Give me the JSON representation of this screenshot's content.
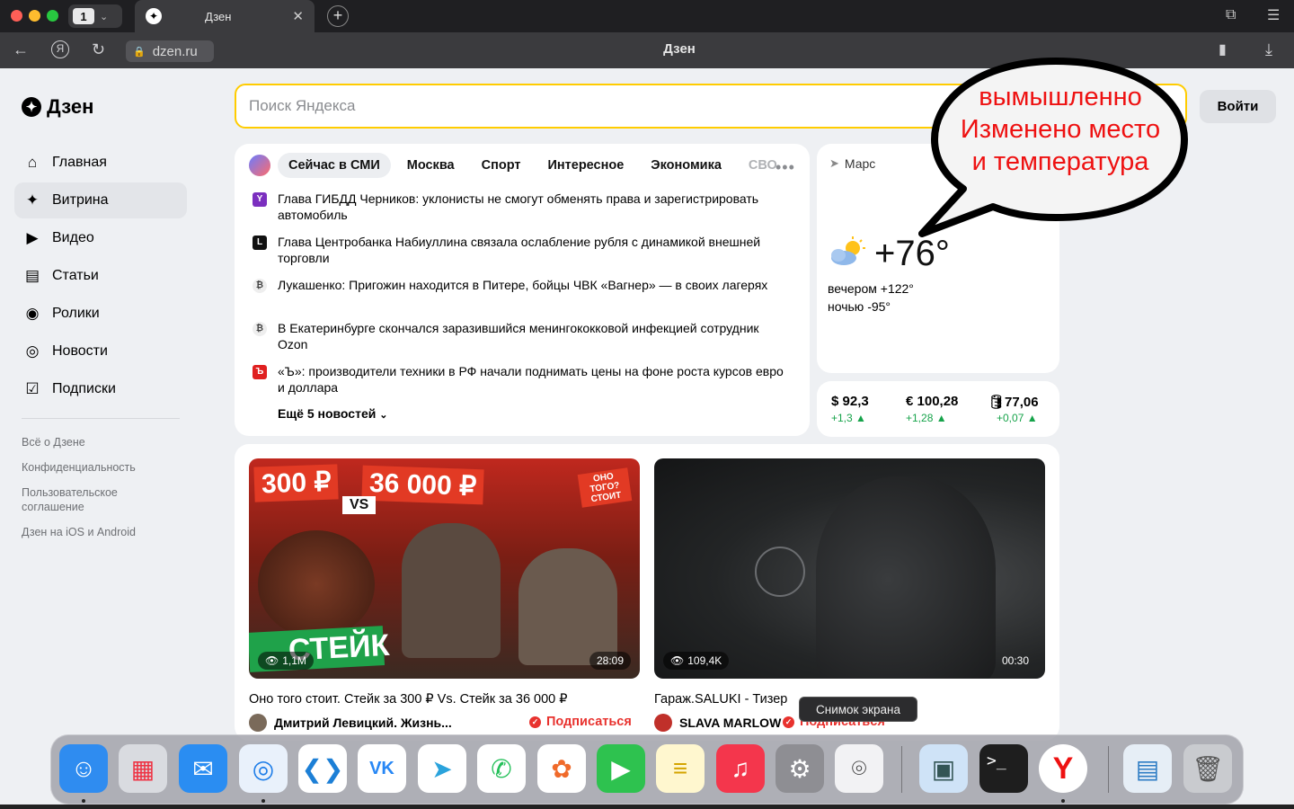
{
  "browser": {
    "tab_count": "1",
    "tab_title": "Дзен",
    "url": "dzen.ru",
    "page_title": "Дзен"
  },
  "sidebar": {
    "logo": "Дзен",
    "items": [
      {
        "label": "Главная",
        "icon": "home-icon"
      },
      {
        "label": "Витрина",
        "icon": "sparkle-icon"
      },
      {
        "label": "Видео",
        "icon": "video-icon"
      },
      {
        "label": "Статьи",
        "icon": "article-icon"
      },
      {
        "label": "Ролики",
        "icon": "clips-icon"
      },
      {
        "label": "Новости",
        "icon": "news-icon"
      },
      {
        "label": "Подписки",
        "icon": "subscriptions-icon"
      }
    ],
    "footer": [
      "Всё о Дзене",
      "Конфиденциальность",
      "Пользовательское соглашение",
      "Дзен на iOS и Android"
    ]
  },
  "search": {
    "placeholder": "Поиск Яндекса"
  },
  "login_label": "Войти",
  "news": {
    "tabs": [
      "Сейчас в СМИ",
      "Москва",
      "Спорт",
      "Интересное",
      "Экономика",
      "СВО"
    ],
    "items": [
      {
        "source": "Y",
        "text": "Глава ГИБДД Черников: уклонисты не смогут обменять права и зарегистрировать автомобиль"
      },
      {
        "source": "L",
        "text": "Глава Центробанка Набиуллина связала ослабление рубля с динамикой внешней торговли"
      },
      {
        "source": "₿",
        "text": "Лукашенко: Пригожин находится в Питере, бойцы ЧВК «Вагнер» — в своих лагерях"
      },
      {
        "source": "₿",
        "text": "В Екатеринбурге скончался заразившийся менингококковой инфекцией сотрудник Ozon"
      },
      {
        "source": "Ъ",
        "text": "«Ъ»: производители техники в РФ начали поднимать цены на фоне роста курсов евро и доллара"
      }
    ],
    "more": "Ещё 5 новостей"
  },
  "weather": {
    "city": "Марс",
    "temp": "+76°",
    "evening": "вечером +122°",
    "night": "ночью -95°"
  },
  "rates": [
    {
      "value": "$ 92,3",
      "delta": "+1,3 ▲"
    },
    {
      "value": "€ 100,28",
      "delta": "+1,28 ▲"
    },
    {
      "value": "🛢77,06",
      "delta": "+0,07 ▲"
    }
  ],
  "feed": [
    {
      "views": "1,1M",
      "duration": "28:09",
      "thumb_text_1": "300 ₽",
      "thumb_text_2": "36 000 ₽",
      "thumb_vs": "VS",
      "thumb_big": "СТЕЙК",
      "thumb_sticker": "ОНО ТОГО? СТОИТ",
      "title": "Оно того стоит. Стейк за 300 ₽ Vs. Стейк за 36 000 ₽",
      "channel": "Дмитрий Левицкий. Жизнь...",
      "subscribe": "Подписаться"
    },
    {
      "views": "109,4K",
      "duration": "00:30",
      "title": "Гараж.SALUKI - Тизер",
      "channel": "SLAVA MARLOW",
      "subscribe": "Подписаться"
    }
  ],
  "annotation": {
    "lines": [
      "вымышленно",
      "Изменено место",
      "и температура"
    ]
  },
  "tooltip": "Снимок экрана",
  "dock": [
    {
      "name": "finder-icon",
      "color": "#2f8cf0",
      "glyph": "☺",
      "running": true
    },
    {
      "name": "launchpad-icon",
      "color": "#d9dbe0",
      "glyph": "▦",
      "running": false
    },
    {
      "name": "mail-icon",
      "color": "#2a8df2",
      "glyph": "✉",
      "running": false
    },
    {
      "name": "safari-icon",
      "color": "#e9f1fb",
      "glyph": "◎",
      "running": true
    },
    {
      "name": "vscode-icon",
      "color": "#ffffff",
      "glyph": "❮❯",
      "running": false
    },
    {
      "name": "vk-icon",
      "color": "#ffffff",
      "glyph": "VK",
      "running": false
    },
    {
      "name": "telegram-icon",
      "color": "#ffffff",
      "glyph": "➤",
      "running": false
    },
    {
      "name": "whatsapp-icon",
      "color": "#ffffff",
      "glyph": "✆",
      "running": false
    },
    {
      "name": "photos-icon",
      "color": "#ffffff",
      "glyph": "✿",
      "running": false
    },
    {
      "name": "facetime-icon",
      "color": "#2ec24f",
      "glyph": "▶",
      "running": false
    },
    {
      "name": "notes-icon",
      "color": "#fff7cf",
      "glyph": "≡",
      "running": false
    },
    {
      "name": "music-icon",
      "color": "#f4364c",
      "glyph": "♫",
      "running": false
    },
    {
      "name": "settings-icon",
      "color": "#8e8e93",
      "glyph": "⚙",
      "running": false
    },
    {
      "name": "screenshot-icon",
      "color": "#f2f2f4",
      "glyph": "⌾",
      "running": false
    },
    {
      "name": "preview-icon",
      "color": "#cfe3f7",
      "glyph": "▣",
      "running": false
    },
    {
      "name": "terminal-icon",
      "color": "#1e1e1e",
      "glyph": ">_",
      "running": false
    },
    {
      "name": "yandex-browser-icon",
      "color": "#ffffff",
      "glyph": "Y",
      "running": true
    },
    {
      "name": "downloads-stack-icon",
      "color": "#e6eef6",
      "glyph": "▤",
      "running": false
    },
    {
      "name": "trash-icon",
      "color": "#c9cbcf",
      "glyph": "🗑",
      "running": false
    }
  ]
}
